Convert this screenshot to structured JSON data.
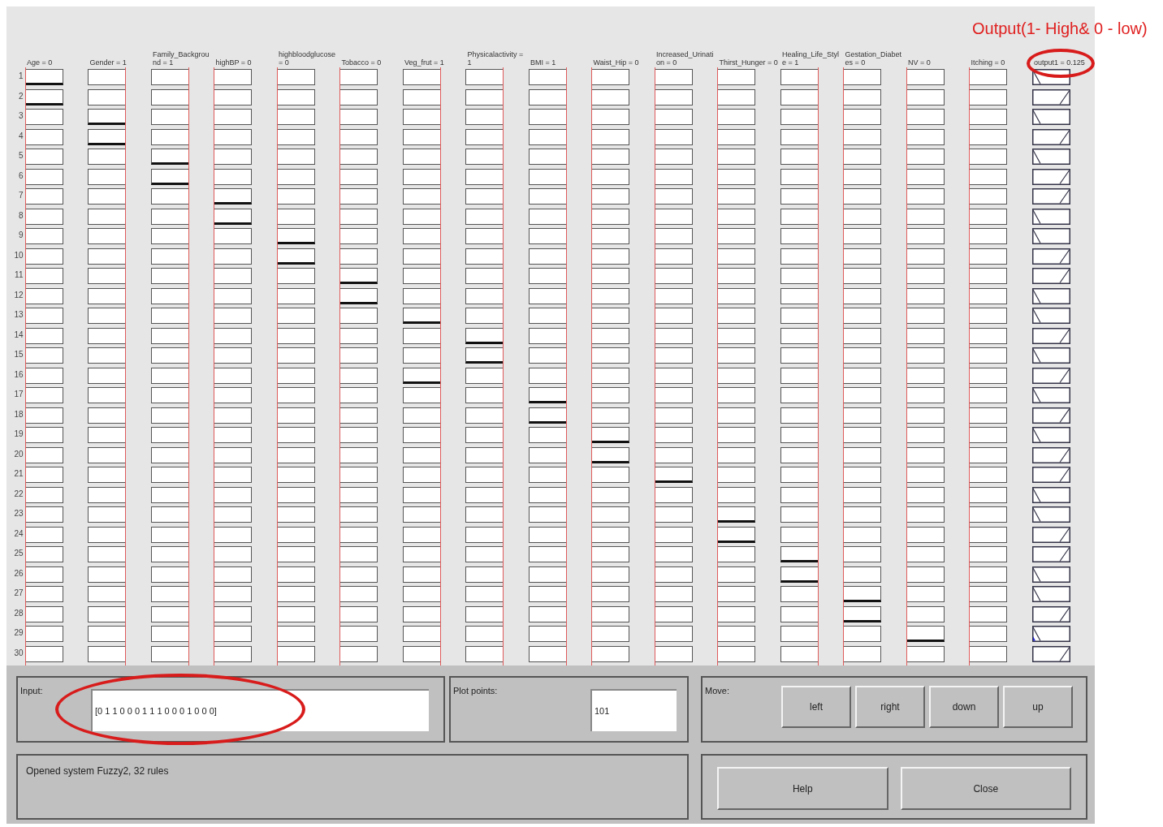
{
  "columns": [
    {
      "header": "Age = 0",
      "at_max": false
    },
    {
      "header": "Gender = 1",
      "at_max": true
    },
    {
      "header": "Family_Background = 1",
      "at_max": true
    },
    {
      "header": "highBP = 0",
      "at_max": false
    },
    {
      "header": "highbloodglucose = 0",
      "at_max": false
    },
    {
      "header": "Tobacco = 0",
      "at_max": false
    },
    {
      "header": "Veg_frut = 1",
      "at_max": true
    },
    {
      "header": "Physicalactivity = 1",
      "at_max": true
    },
    {
      "header": "BMI = 1",
      "at_max": true
    },
    {
      "header": "Waist_Hip = 0",
      "at_max": false
    },
    {
      "header": "Increased_Urination = 0",
      "at_max": false
    },
    {
      "header": "Thirst_Hunger = 0",
      "at_max": false
    },
    {
      "header": "Healing_Life_Style = 1",
      "at_max": true
    },
    {
      "header": "Gestation_Diabetes = 0",
      "at_max": false
    },
    {
      "header": "NV = 0",
      "at_max": false
    },
    {
      "header": "Itching = 0",
      "at_max": false
    }
  ],
  "output": {
    "header": "output1 = 0.125"
  },
  "annotation": {
    "text": "Output(1- High& 0 - low)"
  },
  "rules": [
    {
      "number": "1",
      "marked": [
        true,
        false,
        false,
        false,
        false,
        false,
        false,
        false,
        false,
        false,
        false,
        false,
        false,
        false,
        false,
        false
      ],
      "rising": false,
      "fired": false
    },
    {
      "number": "2",
      "marked": [
        true,
        false,
        false,
        false,
        false,
        false,
        false,
        false,
        false,
        false,
        false,
        false,
        false,
        false,
        false,
        false
      ],
      "rising": true,
      "fired": false
    },
    {
      "number": "3",
      "marked": [
        false,
        true,
        false,
        false,
        false,
        false,
        false,
        false,
        false,
        false,
        false,
        false,
        false,
        false,
        false,
        false
      ],
      "rising": false,
      "fired": false
    },
    {
      "number": "4",
      "marked": [
        false,
        true,
        false,
        false,
        false,
        false,
        false,
        false,
        false,
        false,
        false,
        false,
        false,
        false,
        false,
        false
      ],
      "rising": true,
      "fired": false
    },
    {
      "number": "5",
      "marked": [
        false,
        false,
        true,
        false,
        false,
        false,
        false,
        false,
        false,
        false,
        false,
        false,
        false,
        false,
        false,
        false
      ],
      "rising": false,
      "fired": false
    },
    {
      "number": "6",
      "marked": [
        false,
        false,
        true,
        false,
        false,
        false,
        false,
        false,
        false,
        false,
        false,
        false,
        false,
        false,
        false,
        false
      ],
      "rising": true,
      "fired": false
    },
    {
      "number": "7",
      "marked": [
        false,
        false,
        false,
        true,
        false,
        false,
        false,
        false,
        false,
        false,
        false,
        false,
        false,
        false,
        false,
        false
      ],
      "rising": true,
      "fired": false
    },
    {
      "number": "8",
      "marked": [
        false,
        false,
        false,
        true,
        false,
        false,
        false,
        false,
        false,
        false,
        false,
        false,
        false,
        false,
        false,
        false
      ],
      "rising": false,
      "fired": false
    },
    {
      "number": "9",
      "marked": [
        false,
        false,
        false,
        false,
        true,
        false,
        false,
        false,
        false,
        false,
        false,
        false,
        false,
        false,
        false,
        false
      ],
      "rising": false,
      "fired": false
    },
    {
      "number": "10",
      "marked": [
        false,
        false,
        false,
        false,
        true,
        false,
        false,
        false,
        false,
        false,
        false,
        false,
        false,
        false,
        false,
        false
      ],
      "rising": true,
      "fired": false
    },
    {
      "number": "11",
      "marked": [
        false,
        false,
        false,
        false,
        false,
        true,
        false,
        false,
        false,
        false,
        false,
        false,
        false,
        false,
        false,
        false
      ],
      "rising": true,
      "fired": false
    },
    {
      "number": "12",
      "marked": [
        false,
        false,
        false,
        false,
        false,
        true,
        false,
        false,
        false,
        false,
        false,
        false,
        false,
        false,
        false,
        false
      ],
      "rising": false,
      "fired": false
    },
    {
      "number": "13",
      "marked": [
        false,
        false,
        false,
        false,
        false,
        false,
        true,
        false,
        false,
        false,
        false,
        false,
        false,
        false,
        false,
        false
      ],
      "rising": false,
      "fired": false
    },
    {
      "number": "14",
      "marked": [
        false,
        false,
        false,
        false,
        false,
        false,
        false,
        true,
        false,
        false,
        false,
        false,
        false,
        false,
        false,
        false
      ],
      "rising": true,
      "fired": false
    },
    {
      "number": "15",
      "marked": [
        false,
        false,
        false,
        false,
        false,
        false,
        false,
        true,
        false,
        false,
        false,
        false,
        false,
        false,
        false,
        false
      ],
      "rising": false,
      "fired": false
    },
    {
      "number": "16",
      "marked": [
        false,
        false,
        false,
        false,
        false,
        false,
        true,
        false,
        false,
        false,
        false,
        false,
        false,
        false,
        false,
        false
      ],
      "rising": true,
      "fired": false
    },
    {
      "number": "17",
      "marked": [
        false,
        false,
        false,
        false,
        false,
        false,
        false,
        false,
        true,
        false,
        false,
        false,
        false,
        false,
        false,
        false
      ],
      "rising": false,
      "fired": false
    },
    {
      "number": "18",
      "marked": [
        false,
        false,
        false,
        false,
        false,
        false,
        false,
        false,
        true,
        false,
        false,
        false,
        false,
        false,
        false,
        false
      ],
      "rising": true,
      "fired": false
    },
    {
      "number": "19",
      "marked": [
        false,
        false,
        false,
        false,
        false,
        false,
        false,
        false,
        false,
        true,
        false,
        false,
        false,
        false,
        false,
        false
      ],
      "rising": false,
      "fired": false
    },
    {
      "number": "20",
      "marked": [
        false,
        false,
        false,
        false,
        false,
        false,
        false,
        false,
        false,
        true,
        false,
        false,
        false,
        false,
        false,
        false
      ],
      "rising": true,
      "fired": false
    },
    {
      "number": "21",
      "marked": [
        false,
        false,
        false,
        false,
        false,
        false,
        false,
        false,
        false,
        false,
        true,
        false,
        false,
        false,
        false,
        false
      ],
      "rising": true,
      "fired": false
    },
    {
      "number": "22",
      "marked": [
        false,
        false,
        false,
        false,
        false,
        false,
        false,
        false,
        false,
        false,
        false,
        false,
        false,
        false,
        false,
        false
      ],
      "rising": false,
      "fired": false
    },
    {
      "number": "23",
      "marked": [
        false,
        false,
        false,
        false,
        false,
        false,
        false,
        false,
        false,
        false,
        false,
        true,
        false,
        false,
        false,
        false
      ],
      "rising": false,
      "fired": false
    },
    {
      "number": "24",
      "marked": [
        false,
        false,
        false,
        false,
        false,
        false,
        false,
        false,
        false,
        false,
        false,
        true,
        false,
        false,
        false,
        false
      ],
      "rising": true,
      "fired": false
    },
    {
      "number": "25",
      "marked": [
        false,
        false,
        false,
        false,
        false,
        false,
        false,
        false,
        false,
        false,
        false,
        false,
        true,
        false,
        false,
        false
      ],
      "rising": true,
      "fired": false
    },
    {
      "number": "26",
      "marked": [
        false,
        false,
        false,
        false,
        false,
        false,
        false,
        false,
        false,
        false,
        false,
        false,
        true,
        false,
        false,
        false
      ],
      "rising": false,
      "fired": false
    },
    {
      "number": "27",
      "marked": [
        false,
        false,
        false,
        false,
        false,
        false,
        false,
        false,
        false,
        false,
        false,
        false,
        false,
        true,
        false,
        false
      ],
      "rising": false,
      "fired": false
    },
    {
      "number": "28",
      "marked": [
        false,
        false,
        false,
        false,
        false,
        false,
        false,
        false,
        false,
        false,
        false,
        false,
        false,
        true,
        false,
        false
      ],
      "rising": true,
      "fired": false
    },
    {
      "number": "29",
      "marked": [
        false,
        false,
        false,
        false,
        false,
        false,
        false,
        false,
        false,
        false,
        false,
        false,
        false,
        false,
        true,
        false
      ],
      "rising": false,
      "fired": true
    },
    {
      "number": "30",
      "marked": [
        false,
        false,
        false,
        false,
        false,
        false,
        false,
        false,
        false,
        false,
        false,
        false,
        false,
        false,
        false,
        false
      ],
      "rising": true,
      "fired": false
    }
  ],
  "input": {
    "label": "Input:",
    "value": "[0 1 1 0 0 0 1 1 1 0 0 0 1 0 0 0]"
  },
  "plot_points": {
    "label": "Plot points:",
    "value": "101"
  },
  "move": {
    "label": "Move:",
    "buttons": [
      "left",
      "right",
      "down",
      "up"
    ]
  },
  "status": "Opened system Fuzzy2, 32 rules",
  "buttons": [
    "Help",
    "Close"
  ]
}
